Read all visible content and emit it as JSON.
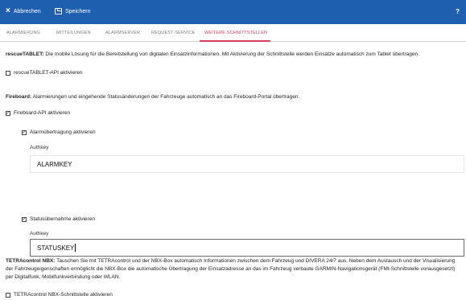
{
  "topbar": {
    "cancel_label": "Abbrechen",
    "save_label": "Speichern",
    "help_label": "?",
    "background": "#1f5fb0"
  },
  "tabs": [
    {
      "label": "ALARMIERUNG"
    },
    {
      "label": "MITTEILUNGEN"
    },
    {
      "label": "ALARMSERVER"
    },
    {
      "label": "REQUEST-SERVICE"
    },
    {
      "label": "WEITERE SCHNITTSTELLEN",
      "active": true
    }
  ],
  "accent_color": "#d63b62",
  "rescue": {
    "title": "rescueTABLET:",
    "description": "Die mobile Lösung für die Bereitstellung von digitalen Einsatzinformationen. Mit Aktivierung der Schnittstelle werden Einsätze automatisch zum Tablet übertragen.",
    "api_checkbox_label": "rescueTABLET-API aktivieren",
    "api_checked": false
  },
  "fireboard": {
    "title": "Fireboard:",
    "description": "Alarmierungen und eingehende Statusänderungen der Fahrzeuge automatisch an das Fireboard-Portal übertragen.",
    "api_checkbox_label": "Fireboard-API aktivieren",
    "api_checked": true,
    "alarm": {
      "checkbox_label": "Alarmübertragung aktivieren",
      "checked": true,
      "field_label": "Authkey",
      "field_value": "ALARMKEY"
    },
    "status": {
      "checkbox_label": "Statusübernahme aktivieren",
      "checked": true,
      "field_label": "Authkey",
      "field_value": "STATUSKEY"
    }
  },
  "tetra": {
    "title": "TETRAcontrol NBX:",
    "description": "Tauschen Sie mit TETRAcontrol und der NBX-Box automatisch Informationen zwischen dem Fahrzeug und DIVERA 24/7 aus. Neben dem Austausch und der Visualisierung der Fahrzeugeigenschaften ermöglicht die NBX-Box die automatische Übertragung der Einsatzadresse an das im Fahrzeug verbaute GARMIN-Navigationsgerät (FMI-Schnittstelle vorausgesetzt) per Digitalfunk, Mobilfunkverbindung oder WLAN.",
    "checkbox_label": "TETRAcontrol NBX-Schnittstelle aktivieren",
    "checked": false
  }
}
